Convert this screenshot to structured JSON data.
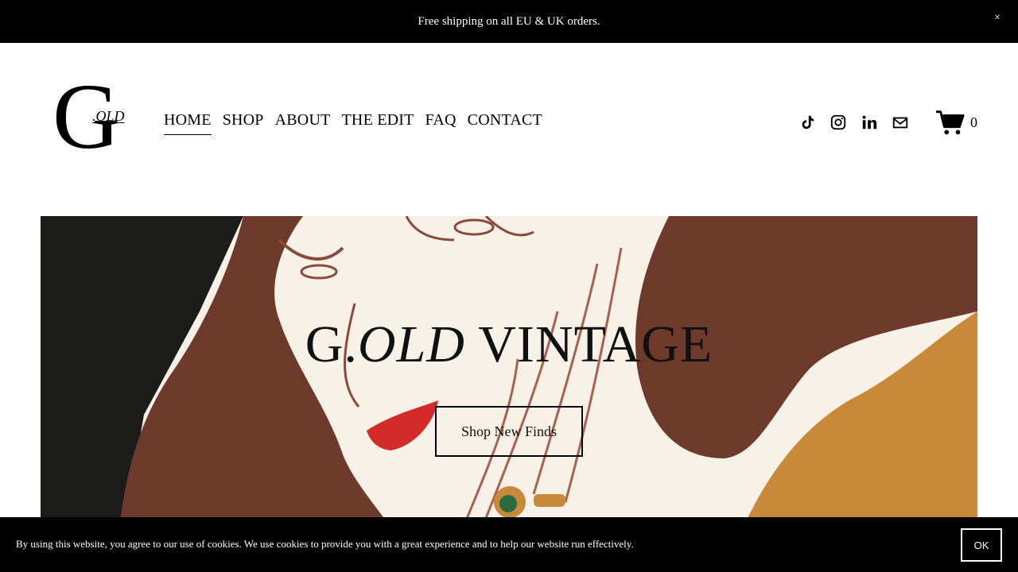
{
  "announcement": {
    "text": "Free shipping on all EU & UK orders.",
    "close_label": "×"
  },
  "logo": {
    "letter": "G",
    "suffix": ".OLD"
  },
  "nav": {
    "items": [
      "HOME",
      "SHOP",
      "ABOUT",
      "THE EDIT",
      "FAQ",
      "CONTACT"
    ],
    "active": "HOME"
  },
  "socials": [
    "tiktok-icon",
    "instagram-icon",
    "linkedin-icon",
    "email-icon"
  ],
  "cart": {
    "count": "0"
  },
  "hero": {
    "title_prefix": "G.",
    "title_italic": "OLD",
    "title_suffix": " VINTAGE",
    "button_label": "Shop New Finds"
  },
  "cookie": {
    "text": "By using this website, you agree to our use of cookies. We use cookies to provide you with a great experience and to help our website run effectively.",
    "ok_label": "OK"
  },
  "colors": {
    "brown": "#6e3a2b",
    "mustard": "#c9893a",
    "dark": "#1c1c1a",
    "cream": "#f7f1e8",
    "lip": "#d42a2a"
  }
}
